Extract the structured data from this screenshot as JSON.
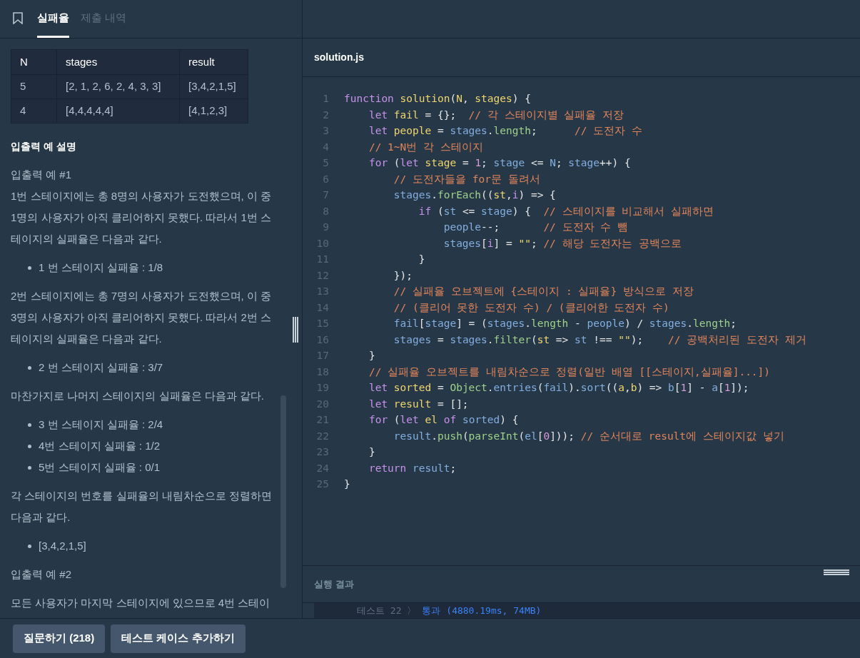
{
  "tabs": [
    {
      "label": "실패율",
      "selected": true
    },
    {
      "label": "제출 내역",
      "selected": false
    }
  ],
  "table": {
    "columns": [
      "N",
      "stages",
      "result"
    ],
    "rows": [
      [
        "5",
        "[2, 1, 2, 6, 2, 4, 3, 3]",
        "[3,4,2,1,5]"
      ],
      [
        "4",
        "[4,4,4,4,4]",
        "[4,1,2,3]"
      ]
    ]
  },
  "description": [
    {
      "kind": "heading",
      "text": "입출력 예 설명"
    },
    {
      "kind": "para",
      "lines": [
        "입출력 예 #1",
        "1번 스테이지에는 총 8명의 사용자가 도전했으며, 이 중",
        "1명의 사용자가 아직 클리어하지 못했다. 따라서 1번 스",
        "테이지의 실패율은 다음과 같다."
      ]
    },
    {
      "kind": "bullets",
      "items": [
        "1 번 스테이지 실패율 : 1/8"
      ]
    },
    {
      "kind": "para",
      "lines": [
        "2번 스테이지에는 총 7명의 사용자가 도전했으며, 이 중",
        "3명의 사용자가 아직 클리어하지 못했다. 따라서 2번 스",
        "테이지의 실패율은 다음과 같다."
      ]
    },
    {
      "kind": "bullets",
      "items": [
        "2 번 스테이지 실패율 : 3/7"
      ]
    },
    {
      "kind": "para",
      "lines": [
        "마찬가지로 나머지 스테이지의 실패율은 다음과 같다."
      ]
    },
    {
      "kind": "bullets",
      "items": [
        "3 번 스테이지 실패율 : 2/4",
        "4번 스테이지 실패율 : 1/2",
        "5번 스테이지 실패율 : 0/1"
      ]
    },
    {
      "kind": "para",
      "lines": [
        "각 스테이지의 번호를 실패율의 내림차순으로 정렬하면",
        "다음과 같다."
      ]
    },
    {
      "kind": "bullets",
      "items": [
        "[3,4,2,1,5]"
      ]
    },
    {
      "kind": "para",
      "lines": [
        "입출력 예 #2"
      ]
    },
    {
      "kind": "para",
      "lines": [
        "모든 사용자가 마지막 스테이지에 있으므로 4번 스테이"
      ]
    }
  ],
  "editor": {
    "filename": "solution.js",
    "lines": [
      {
        "number": "1",
        "tokens": [
          {
            "kind": "kw",
            "text": "function"
          },
          {
            "kind": "def",
            "text": " solution"
          },
          {
            "kind": "p",
            "text": "("
          },
          {
            "kind": "def",
            "text": "N"
          },
          {
            "kind": "p",
            "text": ", "
          },
          {
            "kind": "def",
            "text": "stages"
          },
          {
            "kind": "p",
            "text": ") {"
          }
        ]
      },
      {
        "number": "2",
        "tokens": [
          {
            "kind": "kw",
            "text": "    let"
          },
          {
            "kind": "def",
            "text": " fail"
          },
          {
            "kind": "p",
            "text": " = {};  "
          },
          {
            "kind": "com",
            "text": "// 각 스테이지별 실패율 저장"
          }
        ]
      },
      {
        "number": "3",
        "tokens": [
          {
            "kind": "kw",
            "text": "    let"
          },
          {
            "kind": "def",
            "text": " people"
          },
          {
            "kind": "p",
            "text": " = "
          },
          {
            "kind": "var",
            "text": "stages"
          },
          {
            "kind": "p",
            "text": "."
          },
          {
            "kind": "prop",
            "text": "length"
          },
          {
            "kind": "p",
            "text": ";      "
          },
          {
            "kind": "com",
            "text": "// 도전자 수"
          }
        ]
      },
      {
        "number": "4",
        "tokens": [
          {
            "kind": "com",
            "text": "    // 1~N번 각 스테이지"
          }
        ]
      },
      {
        "number": "5",
        "tokens": [
          {
            "kind": "kw",
            "text": "    for"
          },
          {
            "kind": "p",
            "text": " ("
          },
          {
            "kind": "kw",
            "text": "let"
          },
          {
            "kind": "def",
            "text": " stage"
          },
          {
            "kind": "p",
            "text": " = "
          },
          {
            "kind": "num",
            "text": "1"
          },
          {
            "kind": "p",
            "text": "; "
          },
          {
            "kind": "var",
            "text": "stage"
          },
          {
            "kind": "p",
            "text": " <= "
          },
          {
            "kind": "var",
            "text": "N"
          },
          {
            "kind": "p",
            "text": "; "
          },
          {
            "kind": "var",
            "text": "stage"
          },
          {
            "kind": "p",
            "text": "++) {"
          }
        ]
      },
      {
        "number": "6",
        "tokens": [
          {
            "kind": "com",
            "text": "        // 도전자들을 for문 돌려서"
          }
        ]
      },
      {
        "number": "7",
        "tokens": [
          {
            "kind": "var",
            "text": "        stages"
          },
          {
            "kind": "p",
            "text": "."
          },
          {
            "kind": "prop",
            "text": "forEach"
          },
          {
            "kind": "p",
            "text": "(("
          },
          {
            "kind": "def",
            "text": "st"
          },
          {
            "kind": "p",
            "text": ","
          },
          {
            "kind": "kw",
            "text": "i"
          },
          {
            "kind": "p",
            "text": ") => {"
          }
        ]
      },
      {
        "number": "8",
        "tokens": [
          {
            "kind": "kw",
            "text": "            if"
          },
          {
            "kind": "p",
            "text": " ("
          },
          {
            "kind": "var",
            "text": "st"
          },
          {
            "kind": "p",
            "text": " <= "
          },
          {
            "kind": "var",
            "text": "stage"
          },
          {
            "kind": "p",
            "text": ") {  "
          },
          {
            "kind": "com",
            "text": "// 스테이지를 비교해서 실패하면"
          }
        ]
      },
      {
        "number": "9",
        "tokens": [
          {
            "kind": "var",
            "text": "                people"
          },
          {
            "kind": "p",
            "text": "--;       "
          },
          {
            "kind": "com",
            "text": "// 도전자 수 뺌"
          }
        ]
      },
      {
        "number": "10",
        "tokens": [
          {
            "kind": "var",
            "text": "                stages"
          },
          {
            "kind": "p",
            "text": "["
          },
          {
            "kind": "kw",
            "text": "i"
          },
          {
            "kind": "p",
            "text": "] = "
          },
          {
            "kind": "str",
            "text": "\"\""
          },
          {
            "kind": "p",
            "text": "; "
          },
          {
            "kind": "com",
            "text": "// 해당 도전자는 공백으로"
          }
        ]
      },
      {
        "number": "11",
        "tokens": [
          {
            "kind": "p",
            "text": "            }"
          }
        ]
      },
      {
        "number": "12",
        "tokens": [
          {
            "kind": "p",
            "text": "        });"
          }
        ]
      },
      {
        "number": "13",
        "tokens": [
          {
            "kind": "com",
            "text": "        // 실패율 오브젝트에 {스테이지 : 실패율} 방식으로 저장"
          }
        ]
      },
      {
        "number": "14",
        "tokens": [
          {
            "kind": "com",
            "text": "        // (클리어 못한 도전자 수) / (클리어한 도전자 수)"
          }
        ]
      },
      {
        "number": "15",
        "tokens": [
          {
            "kind": "var",
            "text": "        fail"
          },
          {
            "kind": "p",
            "text": "["
          },
          {
            "kind": "var",
            "text": "stage"
          },
          {
            "kind": "p",
            "text": "] = ("
          },
          {
            "kind": "var",
            "text": "stages"
          },
          {
            "kind": "p",
            "text": "."
          },
          {
            "kind": "prop",
            "text": "length"
          },
          {
            "kind": "p",
            "text": " - "
          },
          {
            "kind": "var",
            "text": "people"
          },
          {
            "kind": "p",
            "text": ") / "
          },
          {
            "kind": "var",
            "text": "stages"
          },
          {
            "kind": "p",
            "text": "."
          },
          {
            "kind": "prop",
            "text": "length"
          },
          {
            "kind": "p",
            "text": ";"
          }
        ]
      },
      {
        "number": "16",
        "tokens": [
          {
            "kind": "var",
            "text": "        stages"
          },
          {
            "kind": "p",
            "text": " = "
          },
          {
            "kind": "var",
            "text": "stages"
          },
          {
            "kind": "p",
            "text": "."
          },
          {
            "kind": "prop",
            "text": "filter"
          },
          {
            "kind": "p",
            "text": "("
          },
          {
            "kind": "def",
            "text": "st"
          },
          {
            "kind": "p",
            "text": " => "
          },
          {
            "kind": "var",
            "text": "st"
          },
          {
            "kind": "p",
            "text": " !== "
          },
          {
            "kind": "str",
            "text": "\"\""
          },
          {
            "kind": "p",
            "text": ");    "
          },
          {
            "kind": "com",
            "text": "// 공백처리된 도전자 제거"
          }
        ]
      },
      {
        "number": "17",
        "tokens": [
          {
            "kind": "p",
            "text": "    }"
          }
        ]
      },
      {
        "number": "18",
        "tokens": [
          {
            "kind": "com",
            "text": "    // 실패율 오브젝트를 내림차순으로 정렬(일반 배열 [[스테이지,실패율]...])"
          }
        ]
      },
      {
        "number": "19",
        "tokens": [
          {
            "kind": "kw",
            "text": "    let"
          },
          {
            "kind": "def",
            "text": " sorted"
          },
          {
            "kind": "p",
            "text": " = "
          },
          {
            "kind": "prop",
            "text": "Object"
          },
          {
            "kind": "p",
            "text": "."
          },
          {
            "kind": "var",
            "text": "entries"
          },
          {
            "kind": "p",
            "text": "("
          },
          {
            "kind": "var",
            "text": "fail"
          },
          {
            "kind": "p",
            "text": ")."
          },
          {
            "kind": "var",
            "text": "sort"
          },
          {
            "kind": "p",
            "text": "(("
          },
          {
            "kind": "def",
            "text": "a"
          },
          {
            "kind": "p",
            "text": ","
          },
          {
            "kind": "def",
            "text": "b"
          },
          {
            "kind": "p",
            "text": ") => "
          },
          {
            "kind": "var",
            "text": "b"
          },
          {
            "kind": "p",
            "text": "["
          },
          {
            "kind": "num",
            "text": "1"
          },
          {
            "kind": "p",
            "text": "] - "
          },
          {
            "kind": "var",
            "text": "a"
          },
          {
            "kind": "p",
            "text": "["
          },
          {
            "kind": "num",
            "text": "1"
          },
          {
            "kind": "p",
            "text": "]);"
          }
        ]
      },
      {
        "number": "20",
        "tokens": [
          {
            "kind": "kw",
            "text": "    let"
          },
          {
            "kind": "def",
            "text": " result"
          },
          {
            "kind": "p",
            "text": " = [];"
          }
        ]
      },
      {
        "number": "21",
        "tokens": [
          {
            "kind": "kw",
            "text": "    for"
          },
          {
            "kind": "p",
            "text": " ("
          },
          {
            "kind": "kw",
            "text": "let"
          },
          {
            "kind": "def",
            "text": " el"
          },
          {
            "kind": "kw",
            "text": " of"
          },
          {
            "kind": "var",
            "text": " sorted"
          },
          {
            "kind": "p",
            "text": ") {"
          }
        ]
      },
      {
        "number": "22",
        "tokens": [
          {
            "kind": "var",
            "text": "        result"
          },
          {
            "kind": "p",
            "text": "."
          },
          {
            "kind": "prop",
            "text": "push"
          },
          {
            "kind": "p",
            "text": "("
          },
          {
            "kind": "prop",
            "text": "parseInt"
          },
          {
            "kind": "p",
            "text": "("
          },
          {
            "kind": "var",
            "text": "el"
          },
          {
            "kind": "p",
            "text": "["
          },
          {
            "kind": "num",
            "text": "0"
          },
          {
            "kind": "p",
            "text": "])); "
          },
          {
            "kind": "com",
            "text": "// 순서대로 result에 스테이지값 넣기"
          }
        ]
      },
      {
        "number": "23",
        "tokens": [
          {
            "kind": "p",
            "text": "    }"
          }
        ]
      },
      {
        "number": "24",
        "tokens": [
          {
            "kind": "kw",
            "text": "    return"
          },
          {
            "kind": "var",
            "text": " result"
          },
          {
            "kind": "p",
            "text": ";"
          }
        ]
      },
      {
        "number": "25",
        "tokens": [
          {
            "kind": "p",
            "text": "}"
          }
        ]
      }
    ]
  },
  "result_panel": {
    "title": "실행 결과",
    "test": "테스트 22",
    "separator": "〉",
    "outcome": "통과 (4880.19ms, 74MB)"
  },
  "buttons": [
    "질문하기 (218)",
    "테스트 케이스 추가하기"
  ]
}
